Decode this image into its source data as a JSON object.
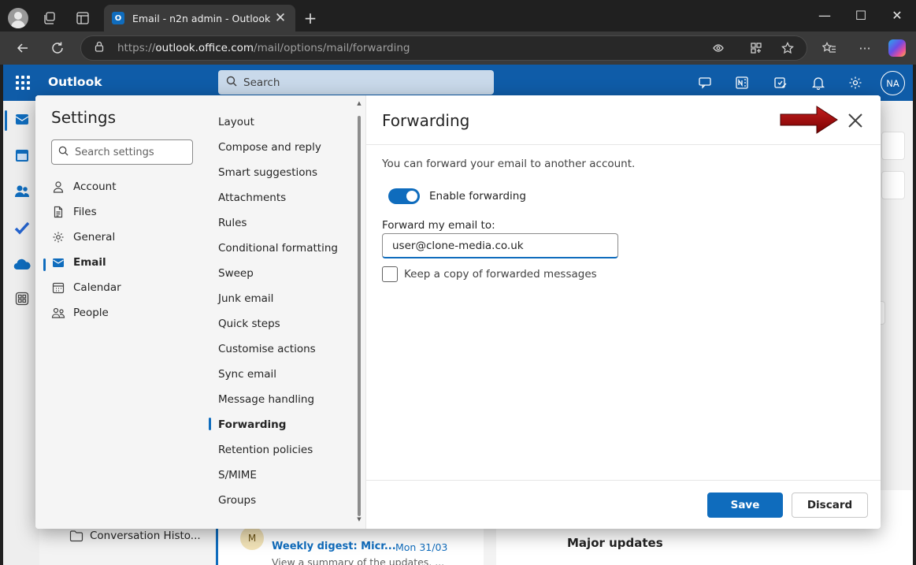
{
  "browser": {
    "tab_title": "Email - n2n admin - Outlook",
    "tab_favicon_letter": "O",
    "url_prefix": "https://",
    "url_host": "outlook.office.com",
    "url_path": "/mail/options/mail/forwarding",
    "window_controls": {
      "minimize": "—",
      "maximize": "☐",
      "close": "✕"
    },
    "new_tab": "+",
    "tab_close": "✕",
    "more": "···"
  },
  "outlook": {
    "brand": "Outlook",
    "search_placeholder": "Search",
    "avatar_initials": "NA",
    "accent_color": "#0f5ca8"
  },
  "background": {
    "folder_item": "Conversation Histo...",
    "message": {
      "avatar_letter": "M",
      "from": "Weekly digest: Micr...",
      "date": "Mon 31/03",
      "preview": "View a summary of the updates, ..."
    },
    "reading_heading": "Major updates"
  },
  "settings": {
    "title": "Settings",
    "search_placeholder": "Search settings",
    "categories": [
      {
        "label": "Account",
        "icon": "person-icon"
      },
      {
        "label": "Files",
        "icon": "file-icon"
      },
      {
        "label": "General",
        "icon": "gear-icon"
      },
      {
        "label": "Email",
        "icon": "mail-icon",
        "active": true
      },
      {
        "label": "Calendar",
        "icon": "calendar-icon"
      },
      {
        "label": "People",
        "icon": "people-icon"
      }
    ],
    "email_sections": [
      "Layout",
      "Compose and reply",
      "Smart suggestions",
      "Attachments",
      "Rules",
      "Conditional formatting",
      "Sweep",
      "Junk email",
      "Quick steps",
      "Customise actions",
      "Sync email",
      "Message handling",
      "Forwarding",
      "Retention policies",
      "S/MIME",
      "Groups"
    ],
    "active_section": "Forwarding"
  },
  "forwarding": {
    "title": "Forwarding",
    "description": "You can forward your email to another account.",
    "enable_label": "Enable forwarding",
    "enabled": true,
    "forward_to_label": "Forward my email to:",
    "forward_to_value": "user@clone-media.co.uk",
    "keep_copy_label": "Keep a copy of forwarded messages",
    "keep_copy_checked": false,
    "save_label": "Save",
    "discard_label": "Discard",
    "primary_color": "#0f6cbd",
    "annotation_arrow_color": "#a00000"
  }
}
